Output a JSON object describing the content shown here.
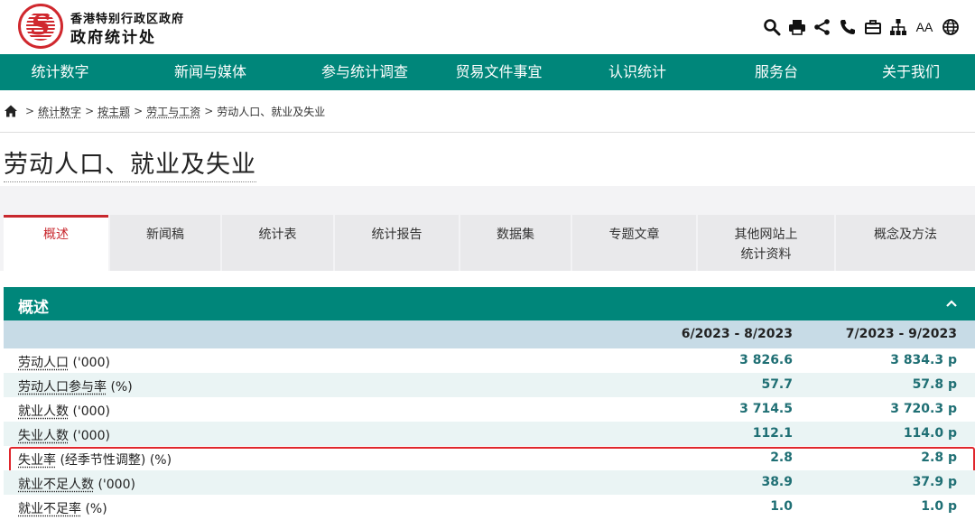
{
  "header": {
    "org_line1": "香港特别行政区政府",
    "org_line2": "政府统计处",
    "font_size_label": "AA"
  },
  "nav": {
    "items": [
      "统计数字",
      "新闻与媒体",
      "参与统计调查",
      "贸易文件事宜",
      "认识统计",
      "服务台",
      "关于我们"
    ]
  },
  "breadcrumb": {
    "items": [
      "统计数字",
      "按主题",
      "劳工与工资"
    ],
    "current": "劳动人口、就业及失业",
    "separator": ">"
  },
  "page": {
    "title": "劳动人口、就业及失业"
  },
  "tabs": [
    {
      "line1": "概述",
      "line2": ""
    },
    {
      "line1": "新闻稿",
      "line2": ""
    },
    {
      "line1": "统计表",
      "line2": ""
    },
    {
      "line1": "统计报告",
      "line2": ""
    },
    {
      "line1": "数据集",
      "line2": ""
    },
    {
      "line1": "专题文章",
      "line2": ""
    },
    {
      "line1": "其他网站上",
      "line2": "统计资料"
    },
    {
      "line1": "概念及方法",
      "line2": ""
    }
  ],
  "section": {
    "title": "概述"
  },
  "table": {
    "columns": [
      "6/2023 - 8/2023",
      "7/2023 - 9/2023"
    ],
    "rows": [
      {
        "term": "劳动人口",
        "unit": " ('000)",
        "v1": "3 826.6",
        "v2": "3 834.3 p"
      },
      {
        "term": "劳动人口参与率",
        "unit": " (%)",
        "v1": "57.7",
        "v2": "57.8 p"
      },
      {
        "term": "就业人数",
        "unit": " ('000)",
        "v1": "3 714.5",
        "v2": "3 720.3 p"
      },
      {
        "term": "失业人数",
        "unit": " ('000)",
        "v1": "112.1",
        "v2": "114.0 p"
      },
      {
        "term": "失业率",
        "unit": " (经季节性调整) (%)",
        "v1": "2.8",
        "v2": "2.8 p"
      },
      {
        "term": "就业不足人数",
        "unit": " ('000)",
        "v1": "38.9",
        "v2": "37.9 p"
      },
      {
        "term": "就业不足率",
        "unit": " (%)",
        "v1": "1.0",
        "v2": "1.0 p"
      }
    ]
  },
  "colors": {
    "brand_green": "#00867a",
    "accent_red": "#c8282e",
    "table_header": "#c7dbe6",
    "value_text": "#1f6f74"
  }
}
